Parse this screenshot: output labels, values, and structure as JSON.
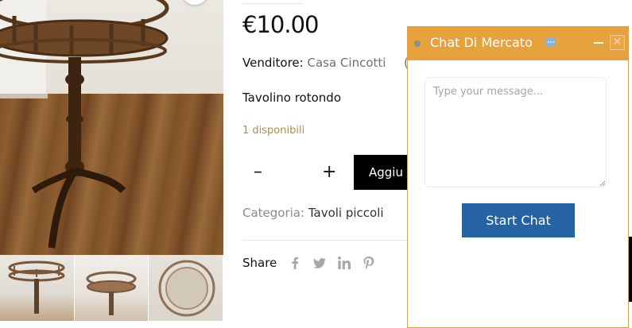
{
  "product": {
    "price": "€10.00",
    "vendor_label": "Venditore:",
    "vendor_name": "Casa Cincotti",
    "vendor_extra": "(",
    "description": "Tavolino rotondo",
    "stock": "1 disponibili",
    "quantity": "",
    "add_to_cart_label": "Aggiu",
    "category_label": "Categoria:",
    "category_value": "Tavoli piccoli",
    "share_label": "Share",
    "share_icons": [
      "facebook-icon",
      "twitter-icon",
      "linkedin-icon",
      "pinterest-icon"
    ],
    "qty_minus": "–",
    "qty_plus": "+"
  },
  "chat": {
    "title": "Chat Di Mercato",
    "message_placeholder": "Type your message...",
    "start_button": "Start Chat",
    "close_symbol": "✕",
    "header_color": "#e6a23c",
    "button_color": "#2563a4"
  },
  "colors": {
    "stock_text": "#b08d4c",
    "muted_text": "#707070",
    "cart_button": "#000000"
  }
}
